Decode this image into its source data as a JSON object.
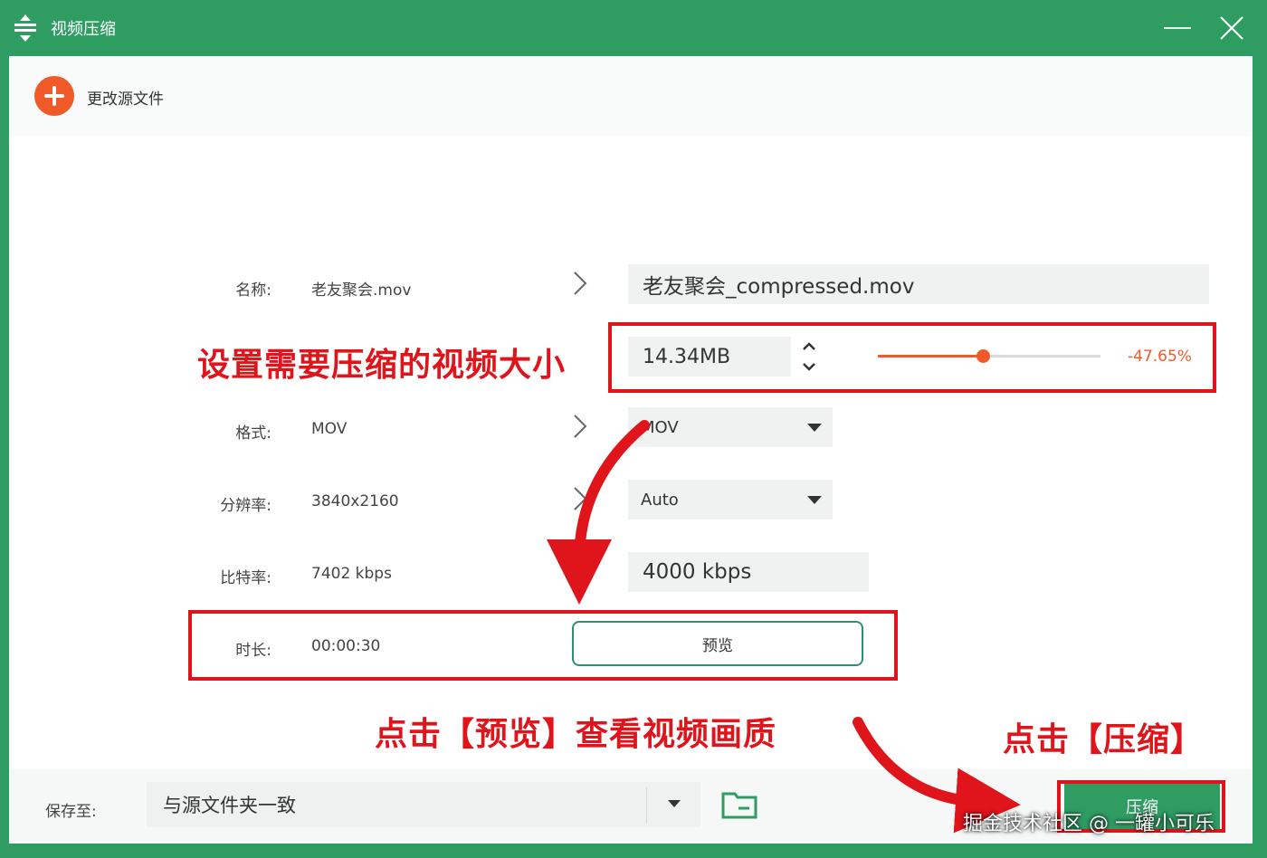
{
  "window": {
    "title": "视频压缩",
    "app_icon": "compress-icon",
    "minimize_icon": "minimize-icon",
    "close_icon": "close-icon"
  },
  "toolbar": {
    "change_source_label": "更改源文件",
    "add_icon": "plus-circle-icon"
  },
  "settings": {
    "name": {
      "label": "名称:",
      "source": "老友聚会.mov",
      "output": "老友聚会_compressed.mov"
    },
    "size": {
      "value": "14.34MB",
      "slider_fraction": 0.47,
      "percent": "-47.65%"
    },
    "format": {
      "label": "格式:",
      "source": "MOV",
      "selected": "MOV"
    },
    "resolution": {
      "label": "分辨率:",
      "source": "3840x2160",
      "selected": "Auto"
    },
    "bitrate": {
      "label": "比特率:",
      "source": "7402 kbps",
      "output": "4000 kbps"
    },
    "duration": {
      "label": "时长:",
      "source": "00:00:30",
      "preview_label": "预览"
    }
  },
  "annotations": {
    "size_hint": "设置需要压缩的视频大小",
    "preview_hint": "点击【预览】查看视频画质",
    "compress_hint": "点击【压缩】",
    "highlight_color": "#e0141b"
  },
  "footer": {
    "save_label": "保存至:",
    "save_location": "与源文件夹一致",
    "folder_icon": "folder-icon",
    "compress_label": "压缩"
  },
  "watermark": "掘金技术社区 @ 一罐小可乐",
  "colors": {
    "accent": "#2f9d62",
    "orange": "#f05a28"
  }
}
